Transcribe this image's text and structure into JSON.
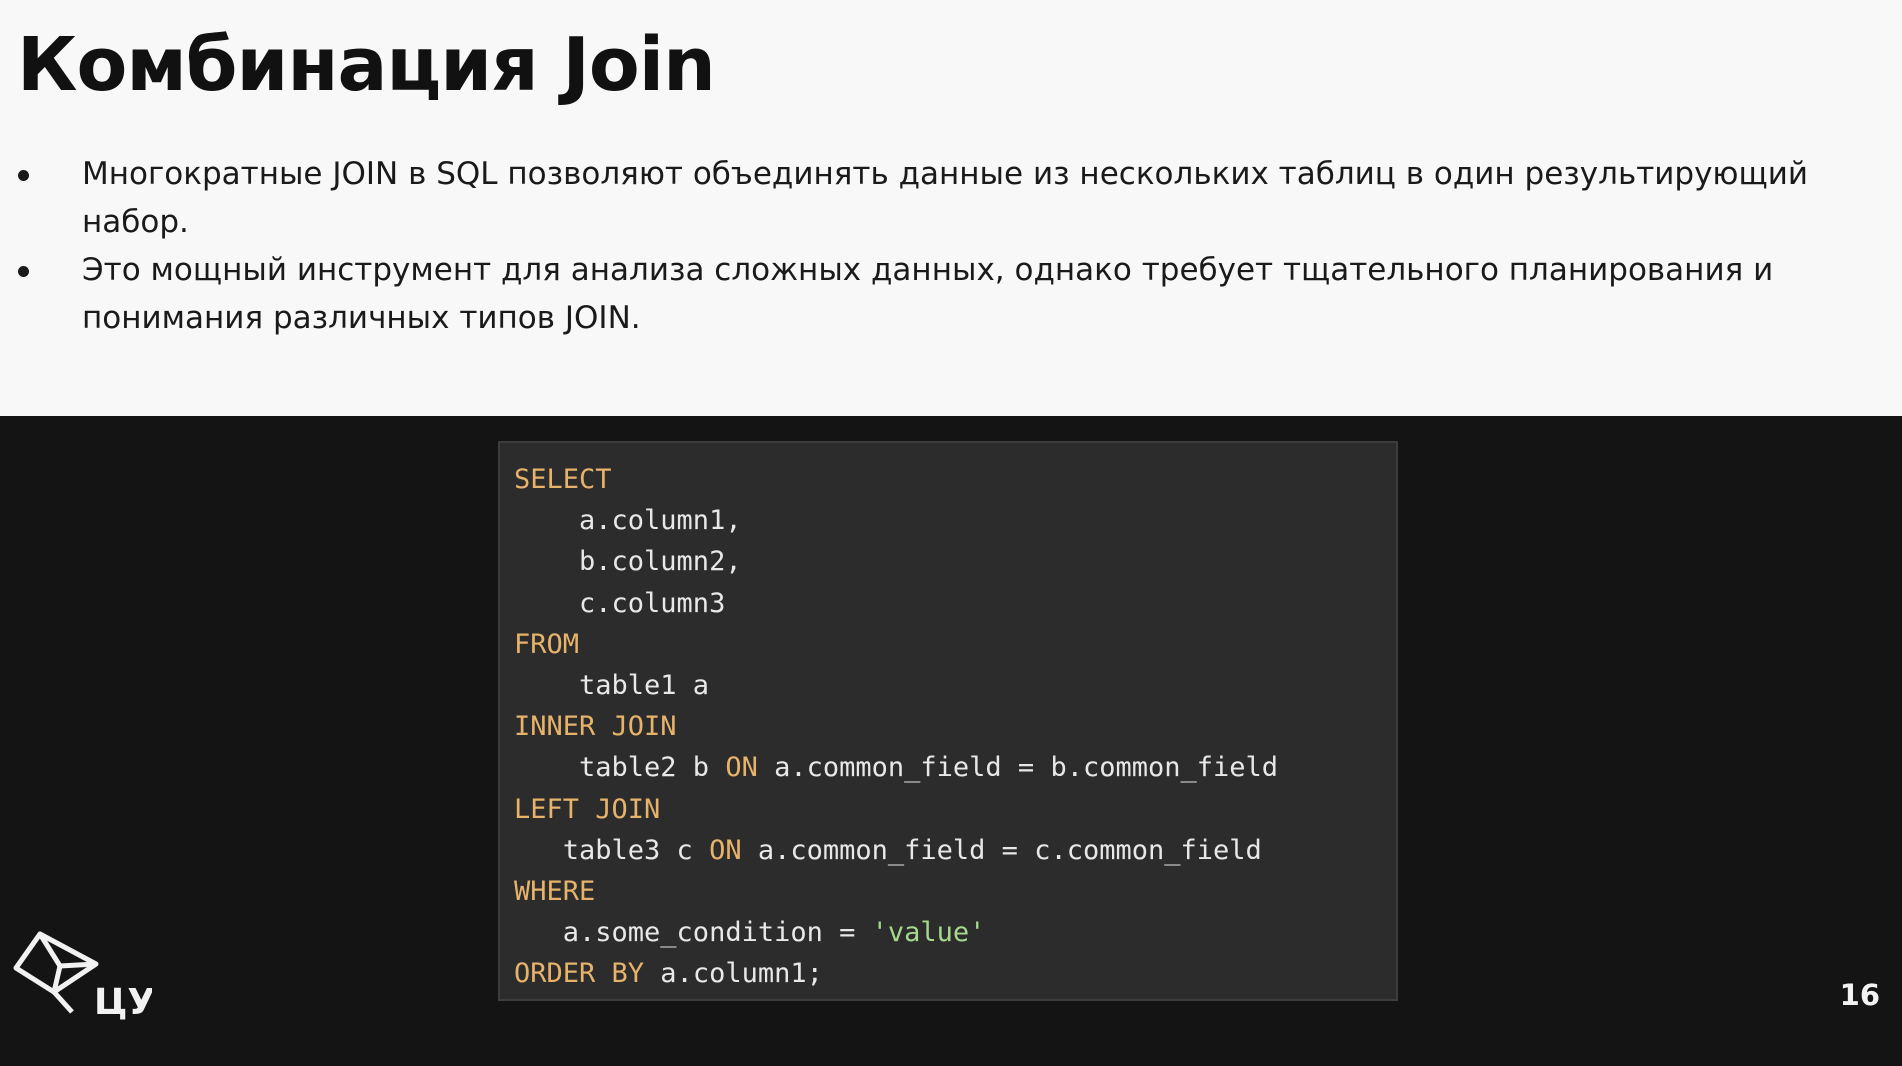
{
  "slide": {
    "title": "Комбинация Join",
    "bullets": [
      "Многократные JOIN в SQL позволяют объединять данные из нескольких таблиц в один результирующий набор.",
      "Это мощный инструмент для анализа сложных данных, однако требует тщательного планирования и понимания различных типов JOIN."
    ],
    "page_number": "16"
  },
  "code": {
    "lines": [
      [
        {
          "t": "SELECT",
          "k": "kw"
        }
      ],
      [
        {
          "t": "    a.column1,",
          "k": ""
        }
      ],
      [
        {
          "t": "    b.column2,",
          "k": ""
        }
      ],
      [
        {
          "t": "    c.column3",
          "k": ""
        }
      ],
      [
        {
          "t": "FROM",
          "k": "kw"
        }
      ],
      [
        {
          "t": "    table1 a",
          "k": ""
        }
      ],
      [
        {
          "t": "INNER JOIN",
          "k": "kw"
        }
      ],
      [
        {
          "t": "    table2 b ",
          "k": ""
        },
        {
          "t": "ON",
          "k": "kw"
        },
        {
          "t": " a.common_field = b.common_field",
          "k": ""
        }
      ],
      [
        {
          "t": "LEFT JOIN",
          "k": "kw"
        }
      ],
      [
        {
          "t": "   table3 c ",
          "k": ""
        },
        {
          "t": "ON",
          "k": "kw"
        },
        {
          "t": " a.common_field = c.common_field",
          "k": ""
        }
      ],
      [
        {
          "t": "WHERE",
          "k": "kw"
        }
      ],
      [
        {
          "t": "   a.some_condition = ",
          "k": ""
        },
        {
          "t": "'value'",
          "k": "str"
        }
      ],
      [
        {
          "t": "ORDER BY",
          "k": "kw"
        },
        {
          "t": " a.column1;",
          "k": ""
        }
      ]
    ]
  },
  "logo": {
    "text": "ЦУ",
    "icon": "cube-logo-icon"
  },
  "colors": {
    "keyword": "#e7b36b",
    "string": "#a6d98d",
    "code_background": "#2c2c2c",
    "slide_background": "#f8f8f8",
    "bottom_background": "#141414"
  }
}
